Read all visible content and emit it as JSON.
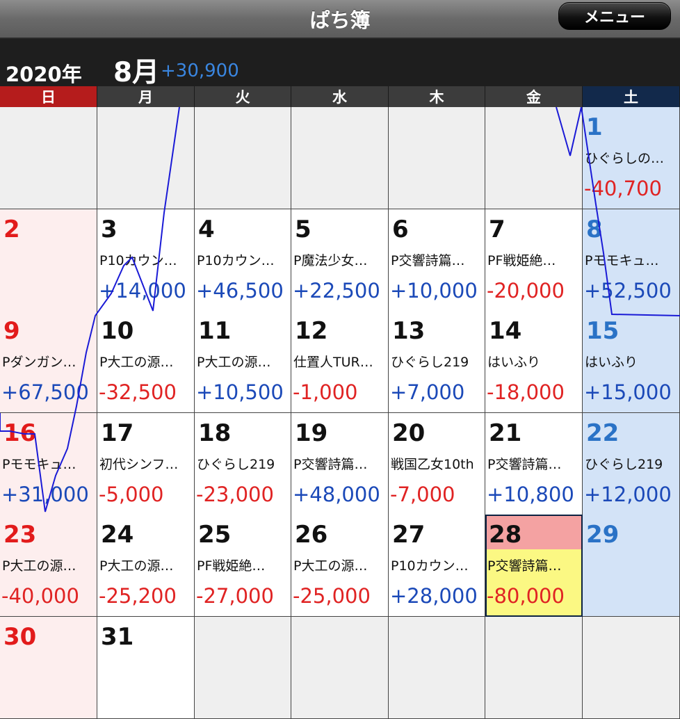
{
  "header": {
    "title": "ぱち簿",
    "menu_label": "メニュー"
  },
  "summary": {
    "year": "2020年",
    "month": "8月",
    "month_total": "+30,900"
  },
  "weekdays": [
    "日",
    "月",
    "火",
    "水",
    "木",
    "金",
    "土"
  ],
  "colors": {
    "sunday": "#b51c1c",
    "saturday": "#12294b",
    "positive": "#1b49b8",
    "negative": "#e02323",
    "today": "#fbf883",
    "trend_line": "#1a1ad6"
  },
  "weeks": [
    [
      {
        "day": "",
        "name": "",
        "amount": ""
      },
      {
        "day": "",
        "name": "",
        "amount": ""
      },
      {
        "day": "",
        "name": "",
        "amount": ""
      },
      {
        "day": "",
        "name": "",
        "amount": ""
      },
      {
        "day": "",
        "name": "",
        "amount": ""
      },
      {
        "day": "",
        "name": "",
        "amount": ""
      },
      {
        "day": "1",
        "name": "ひぐらしの…",
        "amount": "-40,700"
      }
    ],
    [
      {
        "day": "2",
        "name": "",
        "amount": ""
      },
      {
        "day": "3",
        "name": "P10カウン…",
        "amount": "+14,000"
      },
      {
        "day": "4",
        "name": "P10カウン…",
        "amount": "+46,500"
      },
      {
        "day": "5",
        "name": "P魔法少女…",
        "amount": "+22,500"
      },
      {
        "day": "6",
        "name": "P交響詩篇…",
        "amount": "+10,000"
      },
      {
        "day": "7",
        "name": "PF戦姫絶…",
        "amount": "-20,000"
      },
      {
        "day": "8",
        "name": "Pモモキュ…",
        "amount": "+52,500"
      }
    ],
    [
      {
        "day": "9",
        "name": "Pダンガン…",
        "amount": "+67,500"
      },
      {
        "day": "10",
        "name": "P大工の源…",
        "amount": "-32,500"
      },
      {
        "day": "11",
        "name": "P大工の源…",
        "amount": "+10,500"
      },
      {
        "day": "12",
        "name": "仕置人TUR…",
        "amount": "-1,000"
      },
      {
        "day": "13",
        "name": "ひぐらし219",
        "amount": "+7,000"
      },
      {
        "day": "14",
        "name": "はいふり",
        "amount": "-18,000"
      },
      {
        "day": "15",
        "name": "はいふり",
        "amount": "+15,000"
      }
    ],
    [
      {
        "day": "16",
        "name": "Pモモキュ…",
        "amount": "+31,000"
      },
      {
        "day": "17",
        "name": "初代シンフ…",
        "amount": "-5,000"
      },
      {
        "day": "18",
        "name": "ひぐらし219",
        "amount": "-23,000"
      },
      {
        "day": "19",
        "name": "P交響詩篇…",
        "amount": "+48,000"
      },
      {
        "day": "20",
        "name": "戦国乙女10th",
        "amount": "-7,000"
      },
      {
        "day": "21",
        "name": "P交響詩篇…",
        "amount": "+10,800"
      },
      {
        "day": "22",
        "name": "ひぐらし219",
        "amount": "+12,000"
      }
    ],
    [
      {
        "day": "23",
        "name": "P大工の源…",
        "amount": "-40,000"
      },
      {
        "day": "24",
        "name": "P大工の源…",
        "amount": "-25,200"
      },
      {
        "day": "25",
        "name": "PF戦姫絶…",
        "amount": "-27,000"
      },
      {
        "day": "26",
        "name": "P大工の源…",
        "amount": "-25,000"
      },
      {
        "day": "27",
        "name": "P10カウン…",
        "amount": "+28,000"
      },
      {
        "day": "28",
        "name": "P交響詩篇…",
        "amount": "-80,000",
        "today": true
      },
      {
        "day": "29",
        "name": "",
        "amount": ""
      }
    ],
    [
      {
        "day": "30",
        "name": "",
        "amount": ""
      },
      {
        "day": "31",
        "name": "",
        "amount": ""
      },
      {
        "day": "",
        "name": "",
        "amount": ""
      },
      {
        "day": "",
        "name": "",
        "amount": ""
      },
      {
        "day": "",
        "name": "",
        "amount": ""
      },
      {
        "day": "",
        "name": "",
        "amount": ""
      },
      {
        "day": "",
        "name": "",
        "amount": ""
      }
    ]
  ]
}
